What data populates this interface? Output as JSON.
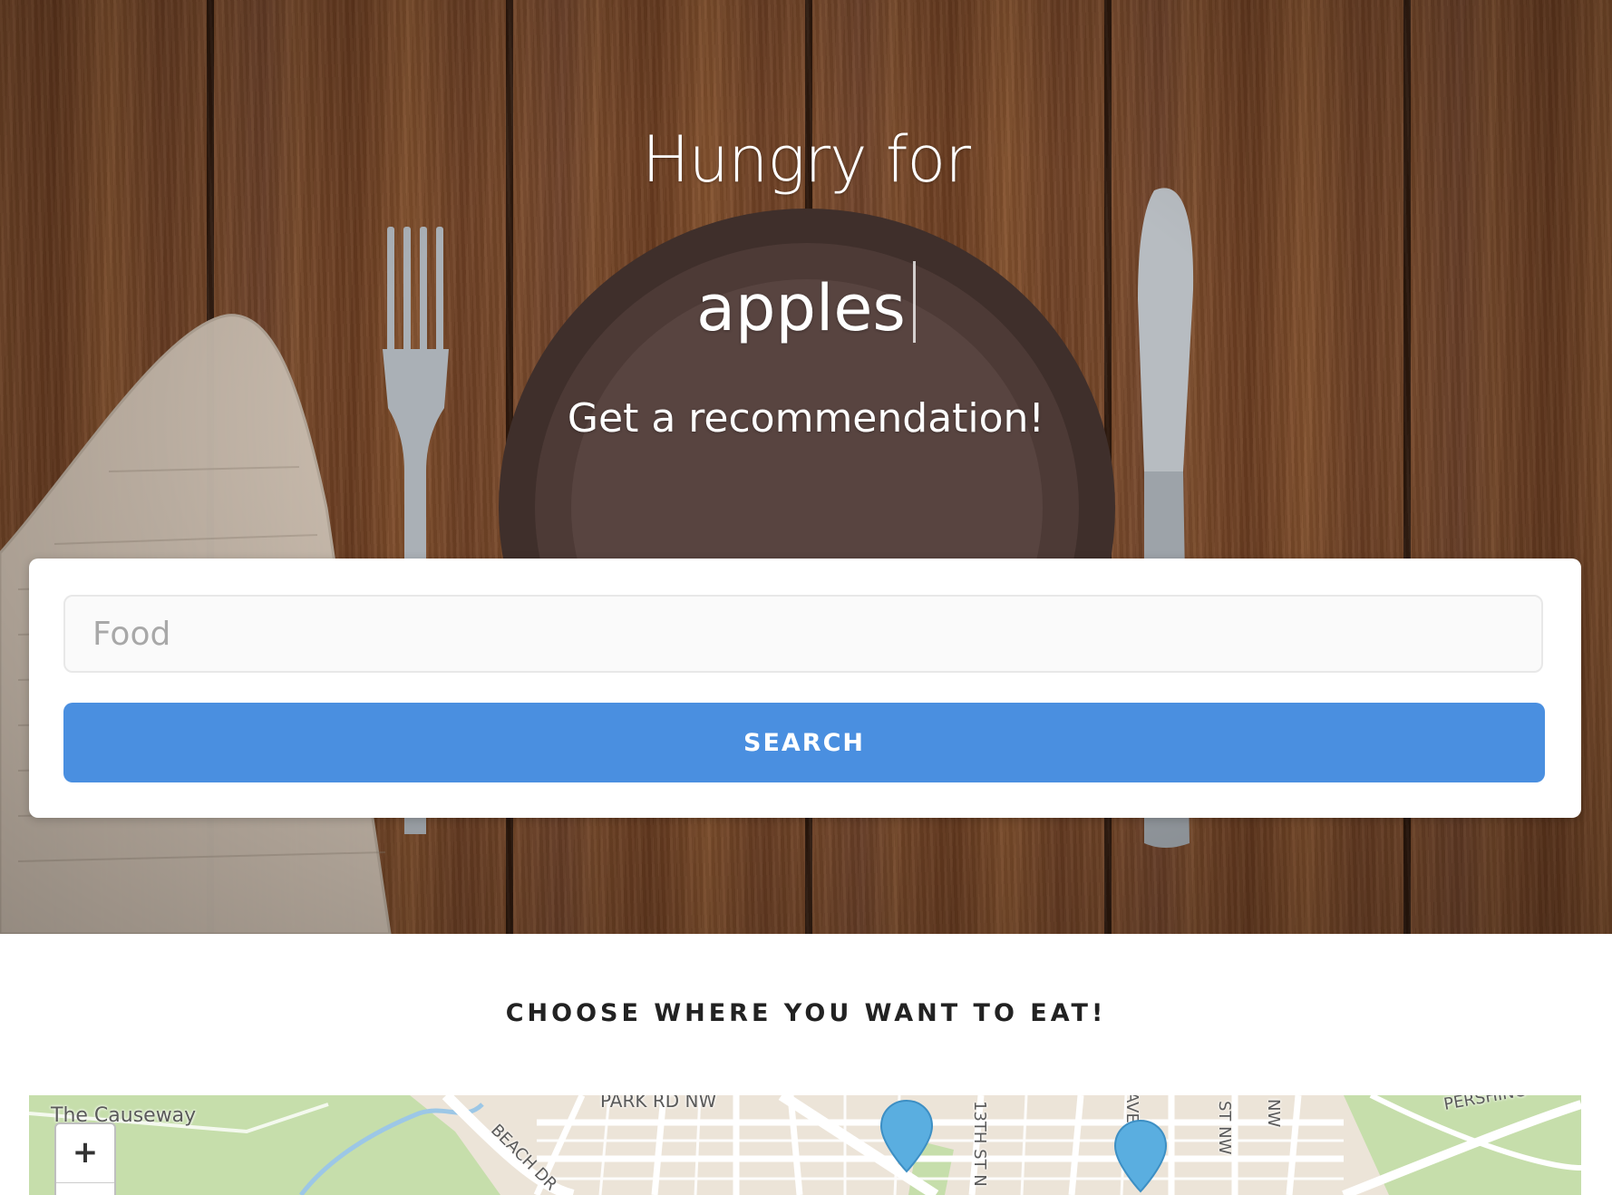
{
  "hero": {
    "title": "Hungry for",
    "typed_text": "apples",
    "subtitle": "Get a recommendation!"
  },
  "search": {
    "placeholder": "Food",
    "value": "",
    "button_label": "SEARCH"
  },
  "section": {
    "heading": "CHOOSE WHERE YOU WANT TO EAT!"
  },
  "map": {
    "labels": {
      "causeway": "The Causeway",
      "park_rd": "PARK RD NW",
      "beach_dr": "BEACH DR",
      "thirteenth_st": "13TH ST N",
      "ave": "AVE",
      "st_nw": "ST NW",
      "nw": "NW",
      "pershing": "PERSHING"
    },
    "zoom_in_label": "+",
    "marker_color": "#5aaee0"
  },
  "colors": {
    "button": "#4a8fe0",
    "heading": "#222222"
  }
}
